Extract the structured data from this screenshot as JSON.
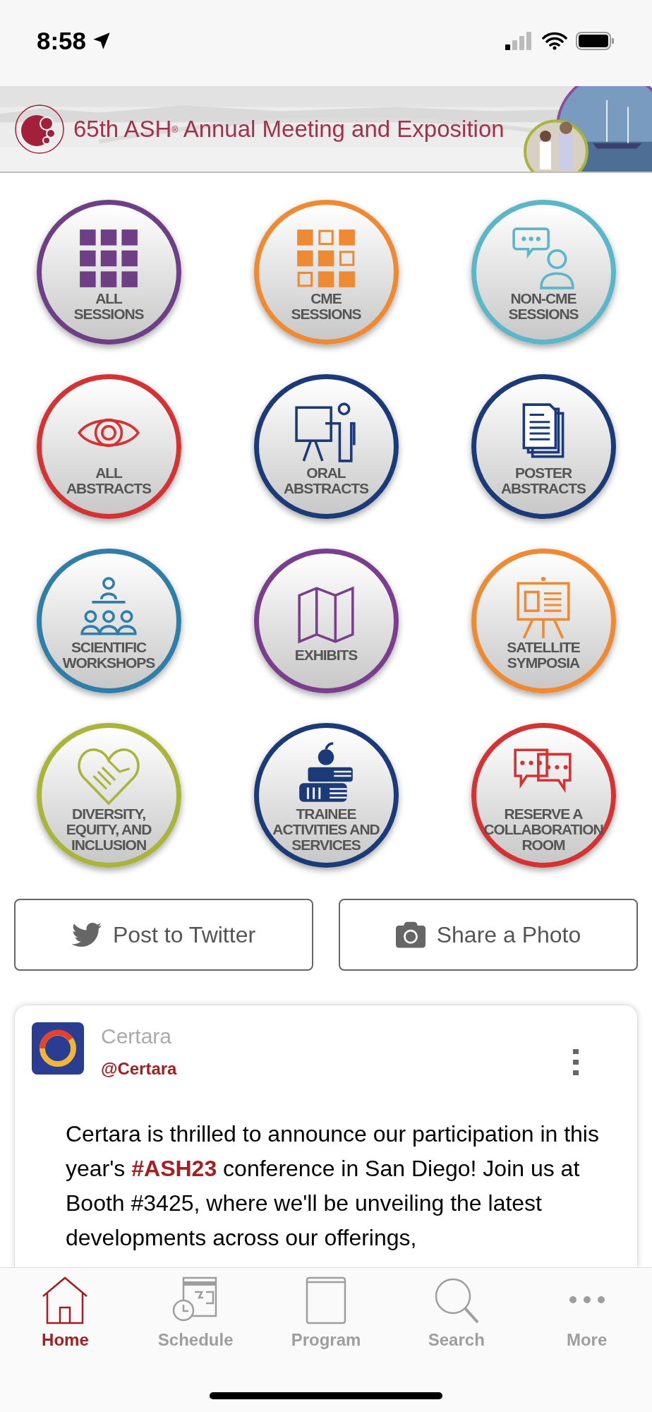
{
  "status_bar": {
    "time": "8:58"
  },
  "banner": {
    "title": "65th ASH$^{®}$ Annual Meeting and Exposition"
  },
  "tiles": [
    {
      "label": "ALL\nSESSIONS",
      "color": "#6f3f85",
      "kind": "grid"
    },
    {
      "label": "CME\nSESSIONS",
      "color": "#ee8a33",
      "kind": "mixed-grid"
    },
    {
      "label": "NON-CME\nSESSIONS",
      "color": "#5bb6c8",
      "kind": "chat-person"
    },
    {
      "label": "ALL\nABSTRACTS",
      "color": "#d33333",
      "kind": "eye"
    },
    {
      "label": "ORAL\nABSTRACTS",
      "color": "#1c3a78",
      "kind": "presenter"
    },
    {
      "label": "POSTER\nABSTRACTS",
      "color": "#1c3a78",
      "kind": "documents"
    },
    {
      "label": "SCIENTIFIC\nWORKSHOPS",
      "color": "#2f7ea8",
      "kind": "people"
    },
    {
      "label": "EXHIBITS",
      "color": "#7a3f8c",
      "kind": "map"
    },
    {
      "label": "SATELLITE\nSYMPOSIA",
      "color": "#ee8a33",
      "kind": "easel"
    },
    {
      "label": "DIVERSITY,\nEQUITY, AND\nINCLUSION",
      "color": "#a9b43a",
      "kind": "handshake"
    },
    {
      "label": "TRAINEE\nACTIVITIES AND\nSERVICES",
      "color": "#1c3a78",
      "kind": "books"
    },
    {
      "label": "RESERVE A\nCOLLABORATION\nROOM",
      "color": "#d33333",
      "kind": "chats"
    }
  ],
  "actions": [
    {
      "label": "Post to Twitter",
      "kind": "twitter"
    },
    {
      "label": "Share a Photo",
      "kind": "camera"
    }
  ],
  "tweet": {
    "author": "Certara",
    "handle": "@Certara",
    "text": "Certara is thrilled to announce our participation in this year's **#ASH23** conference in San Diego! Join us at Booth #3425, where we'll be unveiling the latest developments across our offerings,"
  },
  "tab_bar": [
    {
      "label": "Home",
      "kind": "home",
      "selected": true
    },
    {
      "label": "Schedule",
      "kind": "schedule",
      "selected": false
    },
    {
      "label": "Program",
      "kind": "program",
      "selected": false
    },
    {
      "label": "Search",
      "kind": "search",
      "selected": false
    },
    {
      "label": "More",
      "kind": "more",
      "selected": false
    }
  ]
}
